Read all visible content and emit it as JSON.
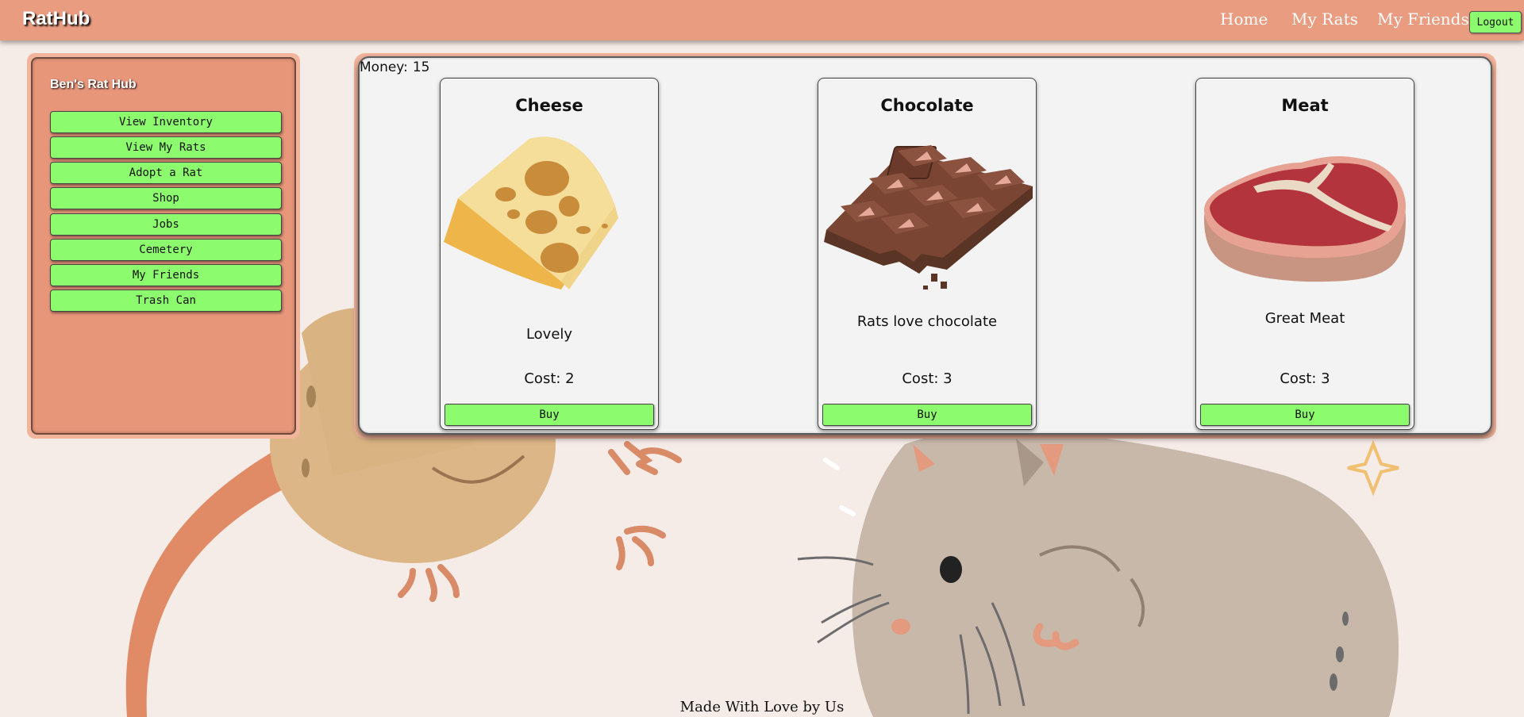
{
  "app": {
    "brand": "RatHub"
  },
  "nav": {
    "home": "Home",
    "my_rats": "My Rats",
    "my_friends": "My Friends",
    "logout": "Logout"
  },
  "sidebar": {
    "title": "Ben's Rat Hub",
    "items": [
      {
        "label": "View Inventory"
      },
      {
        "label": "View My Rats"
      },
      {
        "label": "Adopt a Rat"
      },
      {
        "label": "Shop"
      },
      {
        "label": "Jobs"
      },
      {
        "label": "Cemetery"
      },
      {
        "label": "My Friends"
      },
      {
        "label": "Trash Can"
      }
    ]
  },
  "shop": {
    "money_label": "Money:",
    "money_value": "15",
    "items": [
      {
        "name": "Cheese",
        "description": "Lovely",
        "cost": "Cost: 2",
        "buy": "Buy",
        "icon": "cheese-image"
      },
      {
        "name": "Chocolate",
        "description": "Rats love chocolate",
        "cost": "Cost: 3",
        "buy": "Buy",
        "icon": "chocolate-image"
      },
      {
        "name": "Meat",
        "description": "Great Meat",
        "cost": "Cost: 3",
        "buy": "Buy",
        "icon": "meat-image"
      }
    ]
  },
  "footer": {
    "text": "Made With Love by Us"
  },
  "colors": {
    "navbar": "#e99c80",
    "button_green": "#8cfb6e",
    "page_bg": "#f5ebe7",
    "panel_bg": "#f4f3f3"
  }
}
